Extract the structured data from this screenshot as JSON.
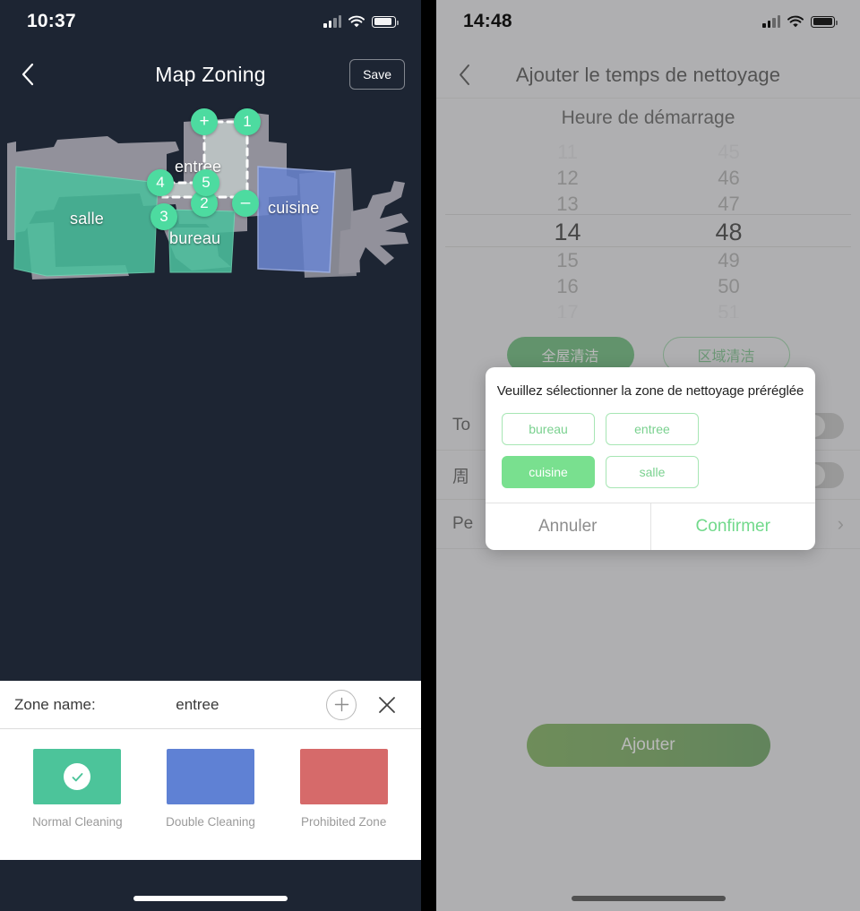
{
  "left_phone": {
    "status_bar": {
      "time": "10:37",
      "signal_icon": "signal-bars-icon",
      "wifi_icon": "wifi-icon",
      "battery_icon": "battery-icon"
    },
    "nav": {
      "back_icon": "chevron-left-icon",
      "title": "Map Zoning",
      "save_label": "Save"
    },
    "map": {
      "zones": [
        {
          "name": "salle",
          "type": "normal",
          "color": "#4cbf9d"
        },
        {
          "name": "entree",
          "type": "editing",
          "color": "#bfe0d4"
        },
        {
          "name": "bureau",
          "type": "normal",
          "color": "#4cbf9d"
        },
        {
          "name": "cuisine",
          "type": "double",
          "color": "#6c86d0"
        }
      ],
      "handles": [
        {
          "label": "+",
          "name": "add-vertex-handle"
        },
        {
          "label": "1",
          "name": "vertex-handle-1"
        },
        {
          "label": "2",
          "name": "vertex-handle-2"
        },
        {
          "label": "3",
          "name": "vertex-handle-3"
        },
        {
          "label": "4",
          "name": "vertex-handle-4"
        },
        {
          "label": "5",
          "name": "vertex-handle-5"
        },
        {
          "label": "–",
          "name": "remove-vertex-handle"
        }
      ]
    },
    "sheet": {
      "zone_name_label": "Zone name:",
      "zone_name_value": "entree",
      "add_icon": "plus-circle-icon",
      "close_icon": "close-x-icon",
      "legend": [
        {
          "caption": "Normal Cleaning",
          "color": "#4cc49a",
          "selected": true
        },
        {
          "caption": "Double Cleaning",
          "color": "#5f81d4",
          "selected": false
        },
        {
          "caption": "Prohibited Zone",
          "color": "#d66a6a",
          "selected": false
        }
      ]
    }
  },
  "right_phone": {
    "status_bar": {
      "time": "14:48",
      "signal_icon": "signal-bars-icon",
      "wifi_icon": "wifi-icon",
      "battery_icon": "battery-icon"
    },
    "nav": {
      "back_icon": "chevron-left-icon",
      "title": "Ajouter le temps de nettoyage"
    },
    "picker": {
      "heading": "Heure de démarrage",
      "hours": [
        "11",
        "12",
        "13",
        "14",
        "15",
        "16",
        "17"
      ],
      "minutes": [
        "45",
        "46",
        "47",
        "48",
        "49",
        "50",
        "51"
      ],
      "selected_hour": "14",
      "selected_minute": "48"
    },
    "mode_buttons": [
      {
        "label": "全屋清洁",
        "style": "filled"
      },
      {
        "label": "区域清洁",
        "style": "outline"
      }
    ],
    "options": [
      {
        "label": "To",
        "control": "toggle"
      },
      {
        "label": "周",
        "control": "toggle"
      },
      {
        "label": "Pe",
        "control": "chevron"
      }
    ],
    "submit_label": "Ajouter"
  },
  "modal": {
    "title": "Veuillez sélectionner la zone de nettoyage préréglée",
    "chips": [
      {
        "label": "bureau",
        "selected": false
      },
      {
        "label": "entree",
        "selected": false
      },
      {
        "label": "cuisine",
        "selected": true
      },
      {
        "label": "salle",
        "selected": false
      }
    ],
    "cancel_label": "Annuler",
    "confirm_label": "Confirmer",
    "accent_color": "#79e08f"
  }
}
